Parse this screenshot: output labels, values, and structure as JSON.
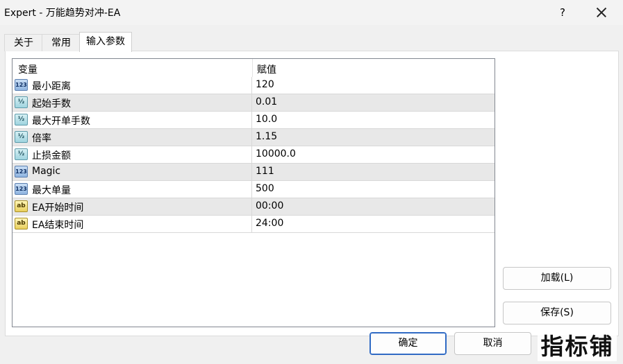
{
  "window": {
    "title": "Expert - 万能趋势对冲-EA",
    "help_label": "?"
  },
  "tabs": [
    {
      "label": "关于",
      "active": false
    },
    {
      "label": "常用",
      "active": false
    },
    {
      "label": "输入参数",
      "active": true
    }
  ],
  "table": {
    "headers": {
      "variable": "变量",
      "value": "赋值"
    },
    "rows": [
      {
        "icon": "int-icon",
        "icon_text": "123",
        "name": "最小距离",
        "value": "120"
      },
      {
        "icon": "double-icon",
        "icon_text": "½",
        "name": "起始手数",
        "value": "0.01"
      },
      {
        "icon": "double-icon",
        "icon_text": "½",
        "name": "最大开单手数",
        "value": "10.0"
      },
      {
        "icon": "double-icon",
        "icon_text": "½",
        "name": "倍率",
        "value": "1.15"
      },
      {
        "icon": "double-icon",
        "icon_text": "½",
        "name": "止损金额",
        "value": "10000.0"
      },
      {
        "icon": "int-icon",
        "icon_text": "123",
        "name": "Magic",
        "value": "111"
      },
      {
        "icon": "int-icon",
        "icon_text": "123",
        "name": "最大单量",
        "value": "500"
      },
      {
        "icon": "string-icon",
        "icon_text": "ab",
        "name": "EA开始时间",
        "value": "00:00"
      },
      {
        "icon": "string-icon",
        "icon_text": "ab",
        "name": "EA结束时间",
        "value": "24:00"
      }
    ]
  },
  "side_buttons": {
    "load": "加载(L)",
    "save": "保存(S)"
  },
  "footer": {
    "ok": "确定",
    "cancel": "取消"
  },
  "watermark": "指标铺"
}
